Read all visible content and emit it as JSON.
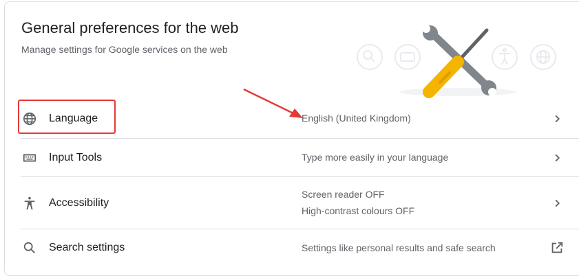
{
  "header": {
    "title": "General preferences for the web",
    "subtitle": "Manage settings for Google services on the web"
  },
  "rows": [
    {
      "label": "Language",
      "icon": "globe-icon",
      "description": [
        "English (United Kingdom)"
      ],
      "action_icon": "chevron-right-icon"
    },
    {
      "label": "Input Tools",
      "icon": "keyboard-icon",
      "description": [
        "Type more easily in your language"
      ],
      "action_icon": "chevron-right-icon"
    },
    {
      "label": "Accessibility",
      "icon": "accessibility-icon",
      "description": [
        "Screen reader OFF",
        "High-contrast colours OFF"
      ],
      "action_icon": "chevron-right-icon"
    },
    {
      "label": "Search settings",
      "icon": "search-icon",
      "description": [
        "Settings like personal results and safe search"
      ],
      "action_icon": "open-in-new-icon"
    }
  ],
  "colors": {
    "annotation": "#e53935",
    "screwdriver_handle": "#f5b400",
    "tool_metal": "#80868b"
  }
}
